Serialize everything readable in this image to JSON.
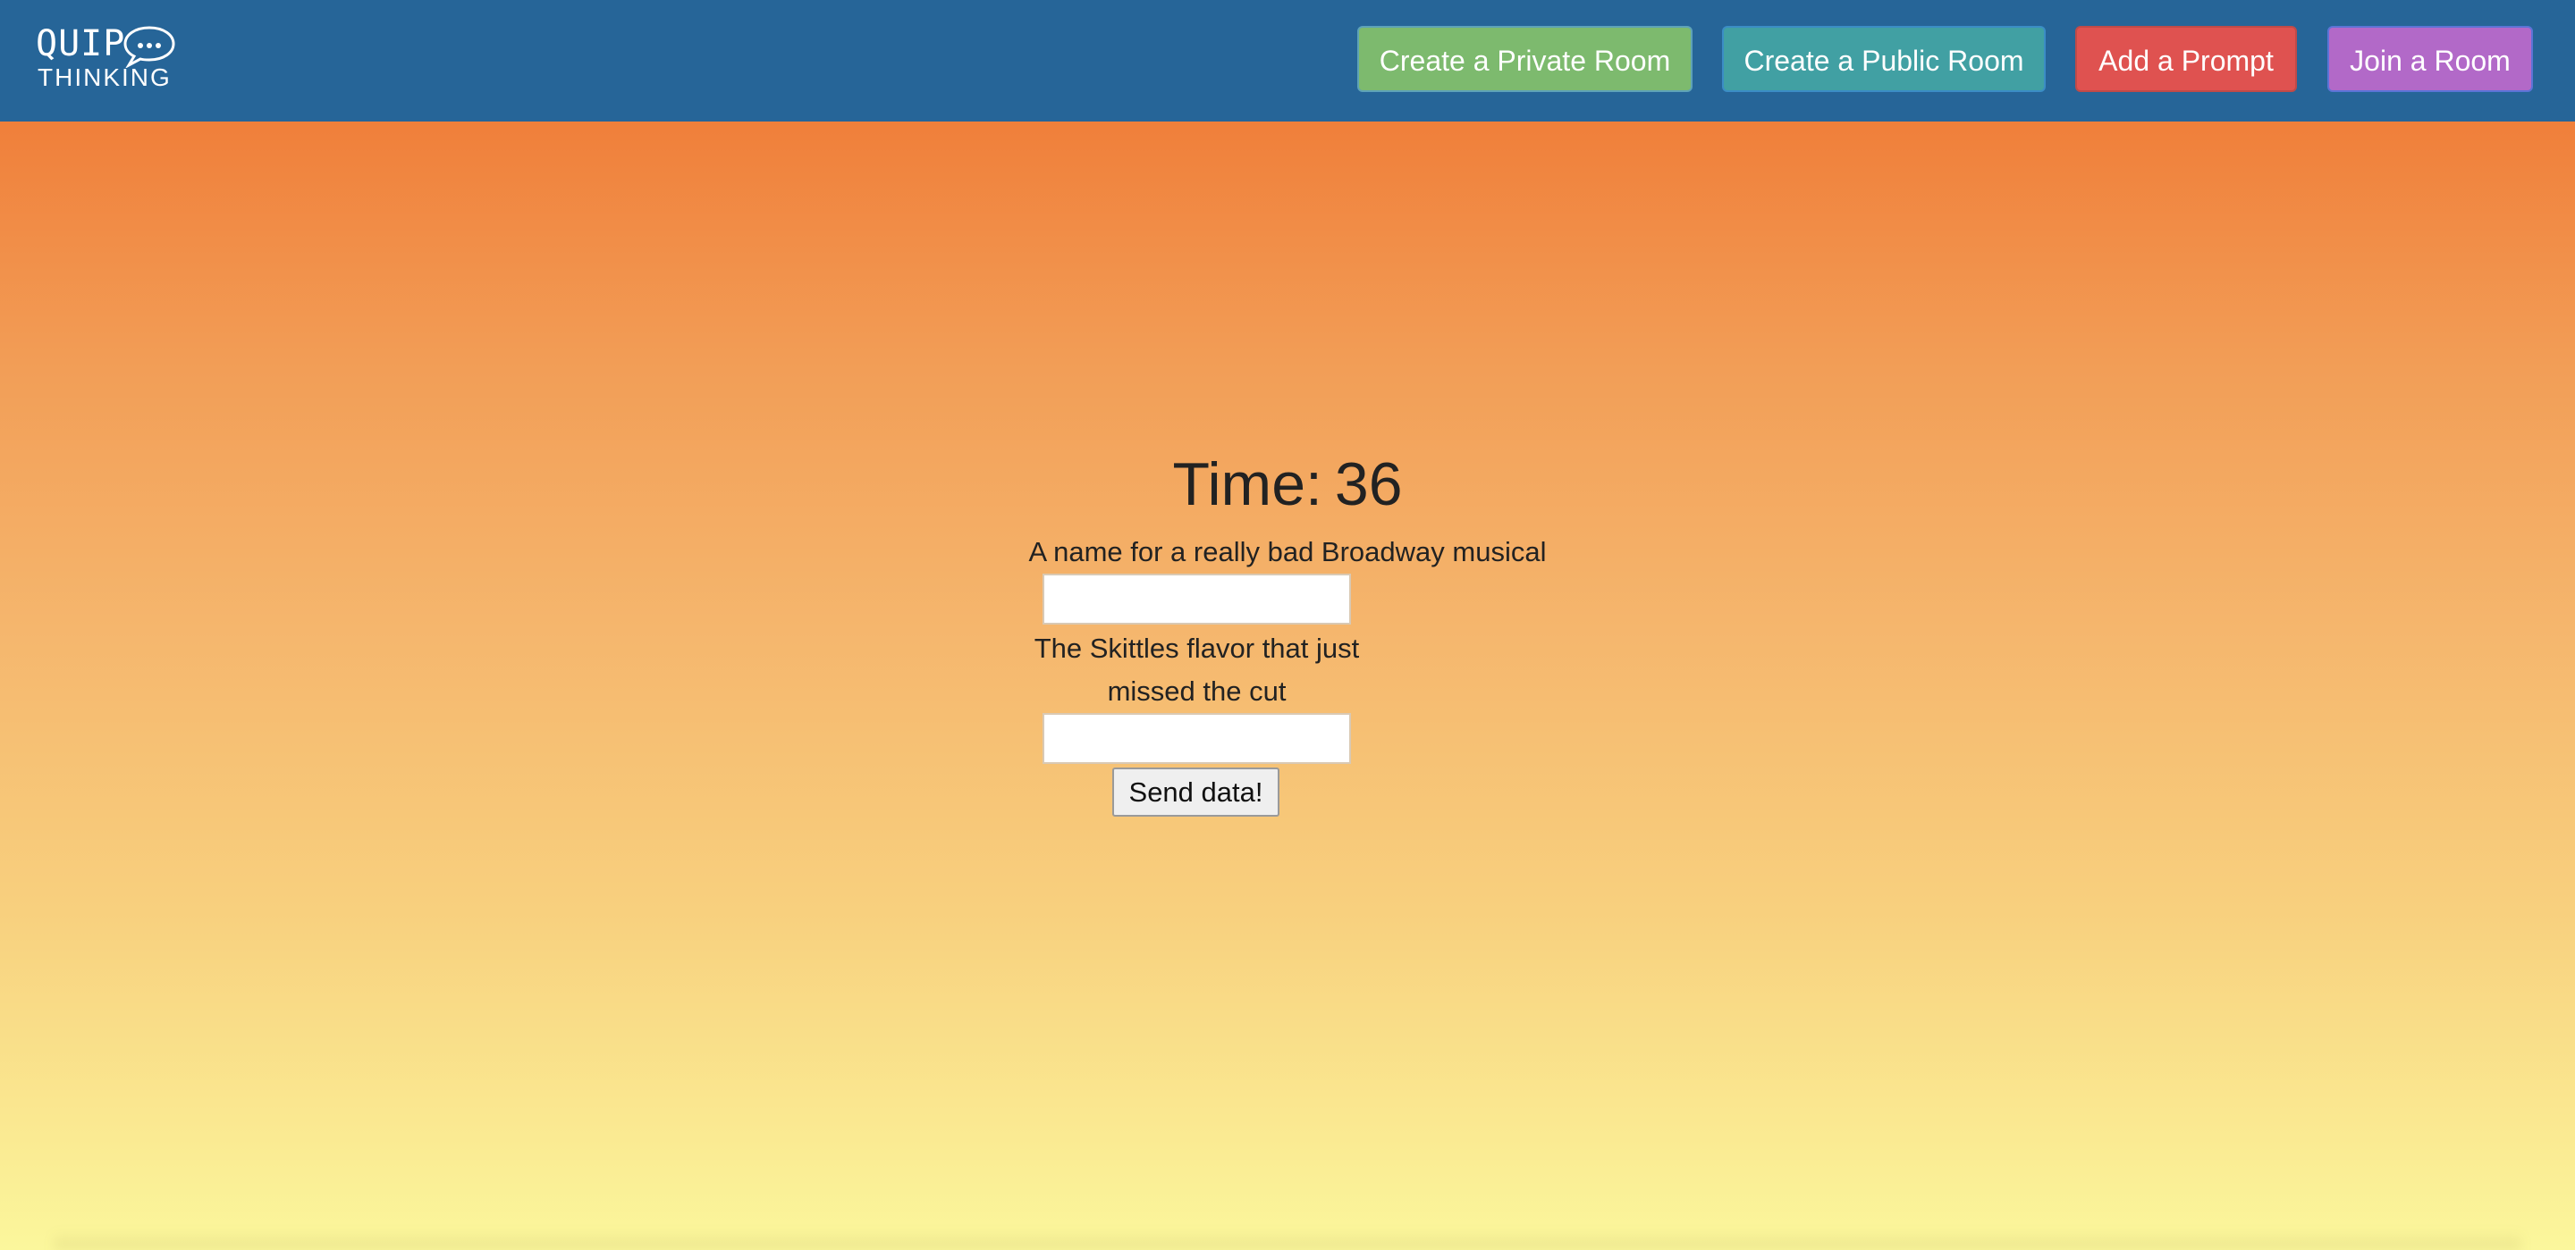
{
  "app": {
    "logo": {
      "word_top": "QUIP",
      "word_bottom": "THINKING",
      "bubble_icon": "speech-bubble-ellipsis-icon"
    }
  },
  "nav": {
    "buttons": [
      {
        "label": "Create a Private Room",
        "color": "#7dba6e"
      },
      {
        "label": "Create a Public Room",
        "color": "#41a0a3"
      },
      {
        "label": "Add a Prompt",
        "color": "#df5250"
      },
      {
        "label": "Join a Room",
        "color": "#b269c8"
      }
    ]
  },
  "game": {
    "timer_label": "Time:",
    "timer_value": "36",
    "prompts": [
      {
        "text": "A name for a really bad Broadway musical",
        "answer": ""
      },
      {
        "text": "The Skittles flavor that just missed the cut",
        "answer": ""
      }
    ],
    "submit_label": "Send data!"
  },
  "colors": {
    "navbar": "#266598",
    "gradient_top": "#f07f3a",
    "gradient_bottom": "#fbf79c"
  }
}
